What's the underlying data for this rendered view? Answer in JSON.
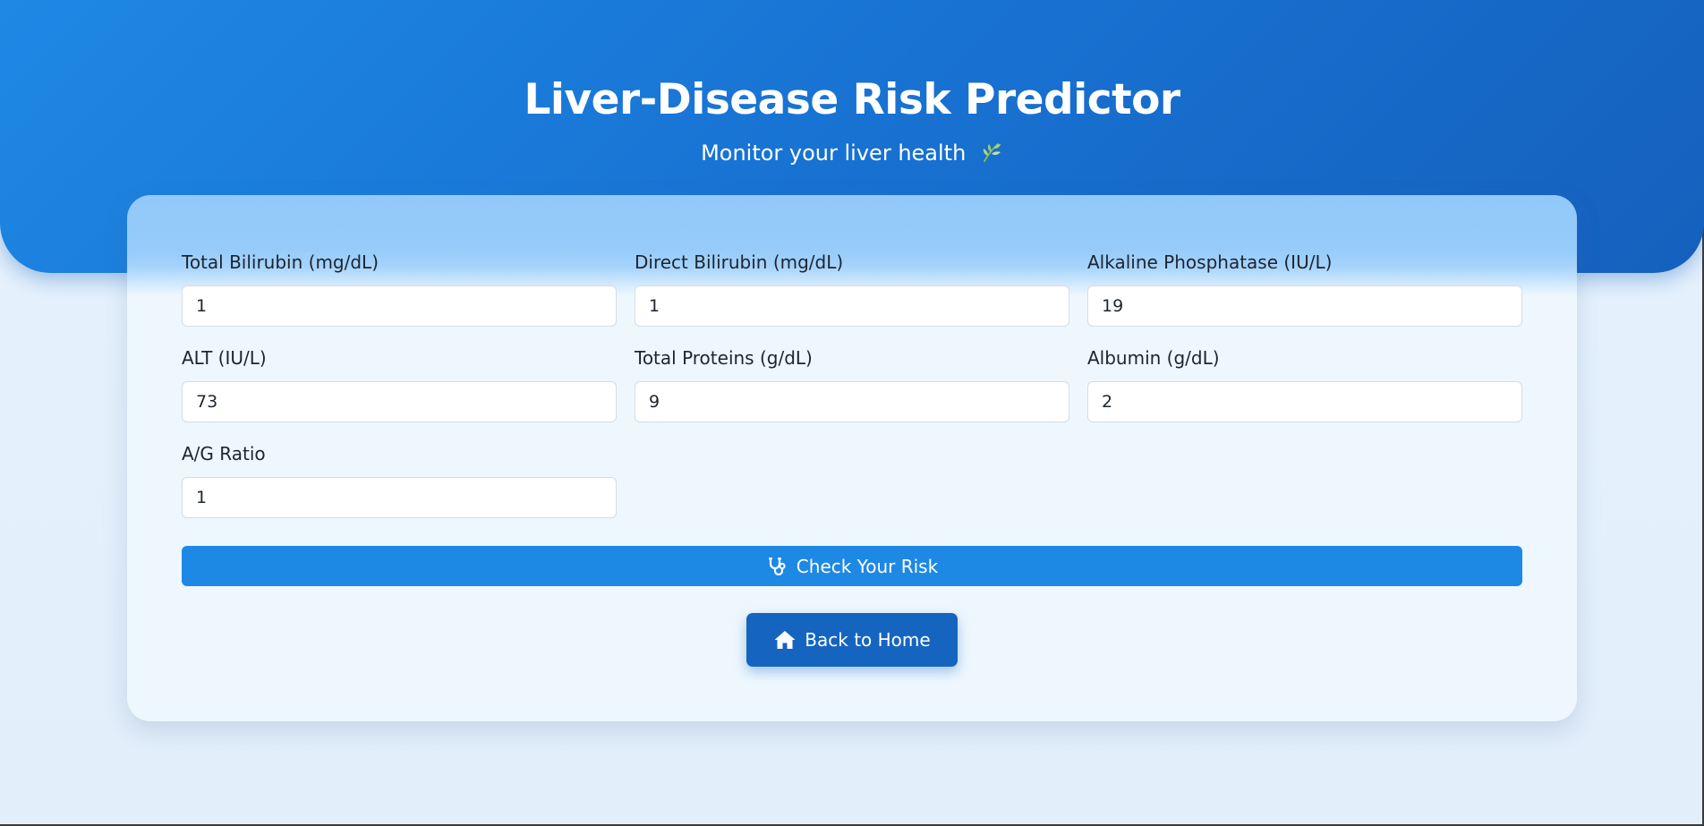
{
  "header": {
    "title": "Liver-Disease Risk Predictor",
    "subtitle": "Monitor your liver health",
    "subtitle_icon": "leaf-icon"
  },
  "form": {
    "fields": [
      {
        "label": "Total Bilirubin (mg/dL)",
        "value": "1"
      },
      {
        "label": "Direct Bilirubin (mg/dL)",
        "value": "1"
      },
      {
        "label": "Alkaline Phosphatase (IU/L)",
        "value": "19"
      },
      {
        "label": "ALT (IU/L)",
        "value": "73"
      },
      {
        "label": "Total Proteins (g/dL)",
        "value": "9"
      },
      {
        "label": "Albumin (g/dL)",
        "value": "2"
      },
      {
        "label": "A/G Ratio",
        "value": "1"
      }
    ],
    "submit_label": "Check Your Risk",
    "submit_icon": "stethoscope-icon"
  },
  "nav": {
    "home_label": "Back to Home",
    "home_icon": "home-icon"
  },
  "colors": {
    "header_gradient_start": "#1e88e5",
    "header_gradient_end": "#1560bd",
    "primary_button": "#1e88e5",
    "home_button": "#1565c0",
    "page_background": "#e3effb",
    "card_background": "#eef7fe"
  }
}
